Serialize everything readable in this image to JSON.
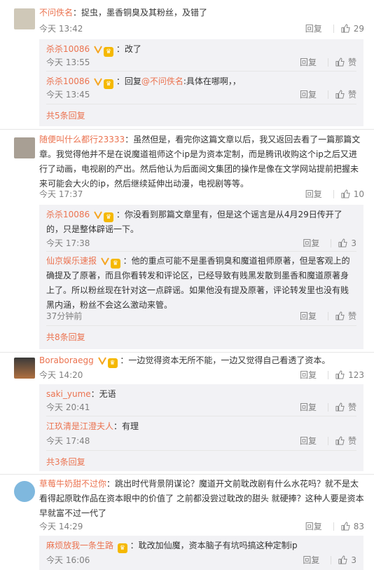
{
  "labels": {
    "reply": "回复",
    "like": "赞"
  },
  "comments": [
    {
      "user": "不问佚名",
      "text": "：捉虫，墨香铜臭及其粉丝，及错了",
      "time": "今天 13:42",
      "likes": "29",
      "replies": [
        {
          "user": "杀杀10086",
          "text": "：改了",
          "time": "今天 13:55"
        },
        {
          "user": "杀杀10086",
          "text_prefix": "：回复",
          "mention": "@不问佚名",
          "text": ":具体在哪啊，，",
          "time": "今天 13:45"
        }
      ],
      "more": "共5条回复"
    },
    {
      "user": "随便叫什么都行23333",
      "text": "：虽然但是，看完你这篇文章以后，我又返回去看了一篇那篇文章。我觉得他并不是在说魔道祖师这个ip是为资本定制，而是腾讯收购这个ip之后又进行了动画，电视剧的产出。然后他认为后面阅文集团的操作是像在文学网站提前把握未来可能会大火的ip，然后继续延伸出动漫，电视剧等等。",
      "time": "今天 17:37",
      "likes": "10",
      "replies": [
        {
          "user": "杀杀10086",
          "text": "：你没看到那篇文章里有，但是这个谣言是从4月29日传开了的，只是整体辟谣一下。",
          "time": "今天 17:38",
          "likes": "3"
        },
        {
          "user": "仙京娱乐速报",
          "text": "：他的重点可能不是墨香铜臭和魔道祖师原著，但是客观上的确提及了原著，而且你看转发和评论区，已经导致有贱黑发散到墨香和魔道原著身上了。所以粉丝现在针对这一点辟谣。如果他没有提及原著，评论转发里也没有贱黑内涵，粉丝不会这么激动来管。",
          "time": "37分钟前"
        }
      ],
      "more": "共8条回复"
    },
    {
      "user": "Boraboraegg",
      "text": "：一边觉得资本无所不能，一边又觉得自己看透了资本。",
      "time": "今天 14:20",
      "likes": "123",
      "replies": [
        {
          "user": "saki_yume",
          "text": "：无语",
          "time": "今天 20:41"
        },
        {
          "user": "江玖清是江澄夫人",
          "text": "：有理",
          "time": "今天 17:48"
        }
      ],
      "more": "共3条回复"
    },
    {
      "user": "草莓牛奶甜不过你",
      "text": "：跳出时代背景阴谋论？魔道开文前耽改剧有什么水花吗？就不是太看得起原耽作品在资本眼中的价值了 之前都没尝过耽改的甜头 就硬捧？这种人要是资本早就富不过一代了",
      "time": "今天 14:29",
      "likes": "83",
      "replies": [
        {
          "user": "麻烦放我一条生路",
          "text": "：耽改加仙魔，资本脑子有坑吗搞这种定制ip",
          "time": "今天 16:06",
          "likes": "3"
        }
      ]
    }
  ]
}
